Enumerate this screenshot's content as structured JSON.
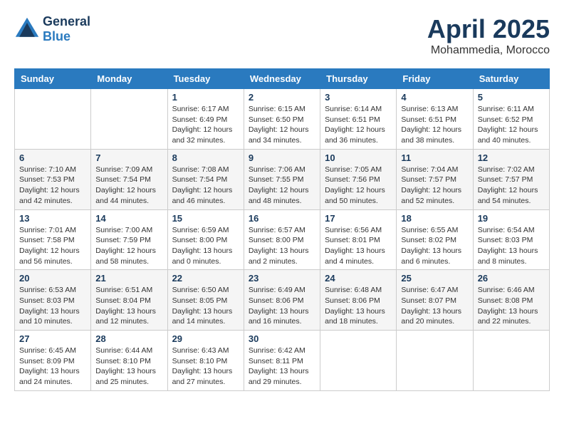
{
  "logo": {
    "general": "General",
    "blue": "Blue"
  },
  "header": {
    "month": "April 2025",
    "location": "Mohammedia, Morocco"
  },
  "weekdays": [
    "Sunday",
    "Monday",
    "Tuesday",
    "Wednesday",
    "Thursday",
    "Friday",
    "Saturday"
  ],
  "weeks": [
    [
      {
        "day": "",
        "sunrise": "",
        "sunset": "",
        "daylight": ""
      },
      {
        "day": "",
        "sunrise": "",
        "sunset": "",
        "daylight": ""
      },
      {
        "day": "1",
        "sunrise": "Sunrise: 6:17 AM",
        "sunset": "Sunset: 6:49 PM",
        "daylight": "Daylight: 12 hours and 32 minutes."
      },
      {
        "day": "2",
        "sunrise": "Sunrise: 6:15 AM",
        "sunset": "Sunset: 6:50 PM",
        "daylight": "Daylight: 12 hours and 34 minutes."
      },
      {
        "day": "3",
        "sunrise": "Sunrise: 6:14 AM",
        "sunset": "Sunset: 6:51 PM",
        "daylight": "Daylight: 12 hours and 36 minutes."
      },
      {
        "day": "4",
        "sunrise": "Sunrise: 6:13 AM",
        "sunset": "Sunset: 6:51 PM",
        "daylight": "Daylight: 12 hours and 38 minutes."
      },
      {
        "day": "5",
        "sunrise": "Sunrise: 6:11 AM",
        "sunset": "Sunset: 6:52 PM",
        "daylight": "Daylight: 12 hours and 40 minutes."
      }
    ],
    [
      {
        "day": "6",
        "sunrise": "Sunrise: 7:10 AM",
        "sunset": "Sunset: 7:53 PM",
        "daylight": "Daylight: 12 hours and 42 minutes."
      },
      {
        "day": "7",
        "sunrise": "Sunrise: 7:09 AM",
        "sunset": "Sunset: 7:54 PM",
        "daylight": "Daylight: 12 hours and 44 minutes."
      },
      {
        "day": "8",
        "sunrise": "Sunrise: 7:08 AM",
        "sunset": "Sunset: 7:54 PM",
        "daylight": "Daylight: 12 hours and 46 minutes."
      },
      {
        "day": "9",
        "sunrise": "Sunrise: 7:06 AM",
        "sunset": "Sunset: 7:55 PM",
        "daylight": "Daylight: 12 hours and 48 minutes."
      },
      {
        "day": "10",
        "sunrise": "Sunrise: 7:05 AM",
        "sunset": "Sunset: 7:56 PM",
        "daylight": "Daylight: 12 hours and 50 minutes."
      },
      {
        "day": "11",
        "sunrise": "Sunrise: 7:04 AM",
        "sunset": "Sunset: 7:57 PM",
        "daylight": "Daylight: 12 hours and 52 minutes."
      },
      {
        "day": "12",
        "sunrise": "Sunrise: 7:02 AM",
        "sunset": "Sunset: 7:57 PM",
        "daylight": "Daylight: 12 hours and 54 minutes."
      }
    ],
    [
      {
        "day": "13",
        "sunrise": "Sunrise: 7:01 AM",
        "sunset": "Sunset: 7:58 PM",
        "daylight": "Daylight: 12 hours and 56 minutes."
      },
      {
        "day": "14",
        "sunrise": "Sunrise: 7:00 AM",
        "sunset": "Sunset: 7:59 PM",
        "daylight": "Daylight: 12 hours and 58 minutes."
      },
      {
        "day": "15",
        "sunrise": "Sunrise: 6:59 AM",
        "sunset": "Sunset: 8:00 PM",
        "daylight": "Daylight: 13 hours and 0 minutes."
      },
      {
        "day": "16",
        "sunrise": "Sunrise: 6:57 AM",
        "sunset": "Sunset: 8:00 PM",
        "daylight": "Daylight: 13 hours and 2 minutes."
      },
      {
        "day": "17",
        "sunrise": "Sunrise: 6:56 AM",
        "sunset": "Sunset: 8:01 PM",
        "daylight": "Daylight: 13 hours and 4 minutes."
      },
      {
        "day": "18",
        "sunrise": "Sunrise: 6:55 AM",
        "sunset": "Sunset: 8:02 PM",
        "daylight": "Daylight: 13 hours and 6 minutes."
      },
      {
        "day": "19",
        "sunrise": "Sunrise: 6:54 AM",
        "sunset": "Sunset: 8:03 PM",
        "daylight": "Daylight: 13 hours and 8 minutes."
      }
    ],
    [
      {
        "day": "20",
        "sunrise": "Sunrise: 6:53 AM",
        "sunset": "Sunset: 8:03 PM",
        "daylight": "Daylight: 13 hours and 10 minutes."
      },
      {
        "day": "21",
        "sunrise": "Sunrise: 6:51 AM",
        "sunset": "Sunset: 8:04 PM",
        "daylight": "Daylight: 13 hours and 12 minutes."
      },
      {
        "day": "22",
        "sunrise": "Sunrise: 6:50 AM",
        "sunset": "Sunset: 8:05 PM",
        "daylight": "Daylight: 13 hours and 14 minutes."
      },
      {
        "day": "23",
        "sunrise": "Sunrise: 6:49 AM",
        "sunset": "Sunset: 8:06 PM",
        "daylight": "Daylight: 13 hours and 16 minutes."
      },
      {
        "day": "24",
        "sunrise": "Sunrise: 6:48 AM",
        "sunset": "Sunset: 8:06 PM",
        "daylight": "Daylight: 13 hours and 18 minutes."
      },
      {
        "day": "25",
        "sunrise": "Sunrise: 6:47 AM",
        "sunset": "Sunset: 8:07 PM",
        "daylight": "Daylight: 13 hours and 20 minutes."
      },
      {
        "day": "26",
        "sunrise": "Sunrise: 6:46 AM",
        "sunset": "Sunset: 8:08 PM",
        "daylight": "Daylight: 13 hours and 22 minutes."
      }
    ],
    [
      {
        "day": "27",
        "sunrise": "Sunrise: 6:45 AM",
        "sunset": "Sunset: 8:09 PM",
        "daylight": "Daylight: 13 hours and 24 minutes."
      },
      {
        "day": "28",
        "sunrise": "Sunrise: 6:44 AM",
        "sunset": "Sunset: 8:10 PM",
        "daylight": "Daylight: 13 hours and 25 minutes."
      },
      {
        "day": "29",
        "sunrise": "Sunrise: 6:43 AM",
        "sunset": "Sunset: 8:10 PM",
        "daylight": "Daylight: 13 hours and 27 minutes."
      },
      {
        "day": "30",
        "sunrise": "Sunrise: 6:42 AM",
        "sunset": "Sunset: 8:11 PM",
        "daylight": "Daylight: 13 hours and 29 minutes."
      },
      {
        "day": "",
        "sunrise": "",
        "sunset": "",
        "daylight": ""
      },
      {
        "day": "",
        "sunrise": "",
        "sunset": "",
        "daylight": ""
      },
      {
        "day": "",
        "sunrise": "",
        "sunset": "",
        "daylight": ""
      }
    ]
  ]
}
